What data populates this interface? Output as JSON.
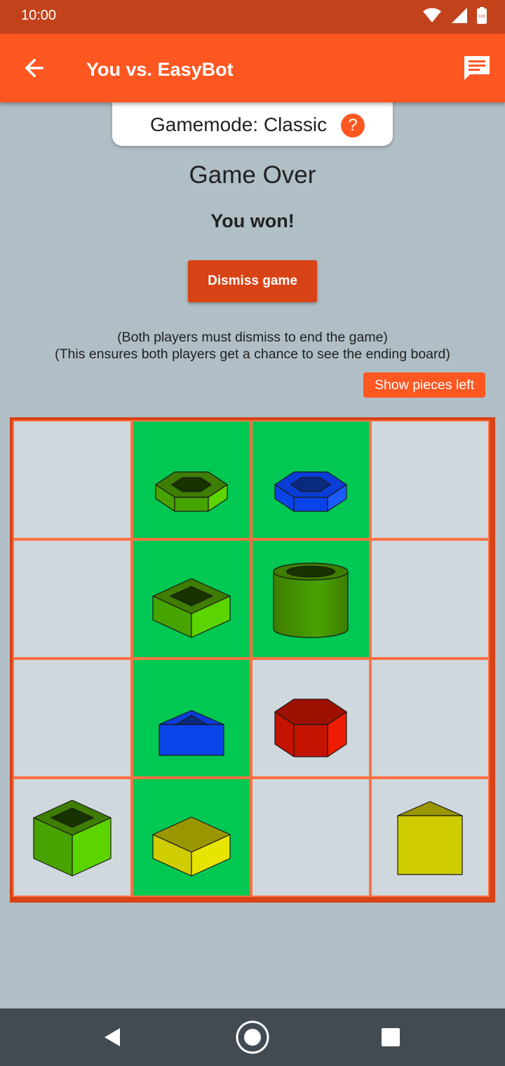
{
  "status_bar": {
    "time": "10:00",
    "battery_level": "100"
  },
  "app_bar": {
    "title": "You vs. EasyBot",
    "back_icon": "arrow-left-icon",
    "chat_icon": "chat-icon"
  },
  "gamemode": {
    "label": "Gamemode: Classic",
    "help_symbol": "?"
  },
  "result": {
    "heading": "Game Over",
    "message": "You won!"
  },
  "dismiss_button": {
    "label": "Dismiss game"
  },
  "notes": {
    "line1": "(Both players must dismiss to end the game)",
    "line2": "(This ensures both players get a chance to see the ending board)"
  },
  "show_pieces_button": {
    "label": "Show pieces left"
  },
  "board": {
    "rows": 4,
    "cols": 4,
    "colors": {
      "board_frame": "#d84315",
      "empty_cell": "#cfd8dc",
      "winning_cell": "#00c853",
      "grid_line": "#ff7043"
    },
    "cells": [
      {
        "row": 0,
        "col": 0,
        "win": false,
        "piece": null
      },
      {
        "row": 0,
        "col": 1,
        "win": true,
        "piece": {
          "color": "green",
          "shape": "hexagon",
          "height": "short",
          "hollow": true
        }
      },
      {
        "row": 0,
        "col": 2,
        "win": true,
        "piece": {
          "color": "blue",
          "shape": "hexagon",
          "height": "short",
          "hollow": true
        }
      },
      {
        "row": 0,
        "col": 3,
        "win": false,
        "piece": null
      },
      {
        "row": 1,
        "col": 0,
        "win": false,
        "piece": null
      },
      {
        "row": 1,
        "col": 1,
        "win": true,
        "piece": {
          "color": "green",
          "shape": "square",
          "height": "short",
          "hollow": true
        }
      },
      {
        "row": 1,
        "col": 2,
        "win": true,
        "piece": {
          "color": "green",
          "shape": "cylinder",
          "height": "tall",
          "hollow": true
        }
      },
      {
        "row": 1,
        "col": 3,
        "win": false,
        "piece": null
      },
      {
        "row": 2,
        "col": 0,
        "win": false,
        "piece": null
      },
      {
        "row": 2,
        "col": 1,
        "win": true,
        "piece": {
          "color": "blue",
          "shape": "triangle",
          "height": "short",
          "hollow": true
        }
      },
      {
        "row": 2,
        "col": 2,
        "win": false,
        "piece": {
          "color": "red",
          "shape": "hexagon",
          "height": "tall",
          "hollow": false
        }
      },
      {
        "row": 2,
        "col": 3,
        "win": false,
        "piece": null
      },
      {
        "row": 3,
        "col": 0,
        "win": false,
        "piece": {
          "color": "green",
          "shape": "square",
          "height": "tall",
          "hollow": true
        }
      },
      {
        "row": 3,
        "col": 1,
        "win": true,
        "piece": {
          "color": "yellow",
          "shape": "square",
          "height": "short",
          "hollow": false
        }
      },
      {
        "row": 3,
        "col": 2,
        "win": false,
        "piece": null
      },
      {
        "row": 3,
        "col": 3,
        "win": false,
        "piece": {
          "color": "yellow",
          "shape": "triangle",
          "height": "tall",
          "hollow": false
        }
      }
    ]
  },
  "nav_bar": {
    "back_icon": "nav-back-icon",
    "home_icon": "nav-home-icon",
    "recents_icon": "nav-recents-icon"
  }
}
